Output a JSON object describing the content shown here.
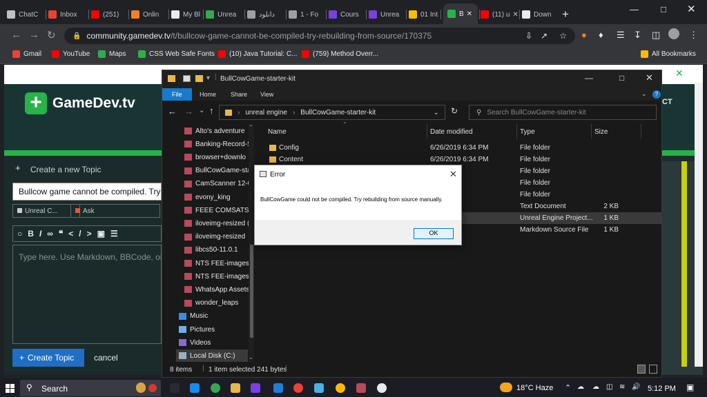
{
  "browser": {
    "tabs": [
      {
        "label": "ChatC",
        "color": "#bdc1c6"
      },
      {
        "label": "Inbox",
        "color": "#ea4335"
      },
      {
        "label": "(251)",
        "color": "#ff0000"
      },
      {
        "label": "Onlin",
        "color": "#f48024"
      },
      {
        "label": "My Bl",
        "color": "#e8eaed"
      },
      {
        "label": "Unrea",
        "color": "#34a853"
      },
      {
        "label": "دانلود",
        "color": "#9aa0a6"
      },
      {
        "label": "1 - Fo",
        "color": "#9aa0a6"
      },
      {
        "label": "Cours",
        "color": "#7b3fe4"
      },
      {
        "label": "Unrea",
        "color": "#7b3fe4"
      },
      {
        "label": "01 Int",
        "color": "#fbbc04"
      },
      {
        "label": "B",
        "color": "#27b24a"
      },
      {
        "label": "(11) u",
        "color": "#ff0000"
      },
      {
        "label": "Down",
        "color": "#e8eaed"
      }
    ],
    "new_tab": "+",
    "url_host": "community.gamedev.tv",
    "url_path": "/t/bullcow-game-cannot-be-compiled-try-rebuilding-from-source/170375",
    "bookmarks": [
      {
        "label": "Gmail",
        "color": "#ea4335"
      },
      {
        "label": "YouTube",
        "color": "#ff0000"
      },
      {
        "label": "Maps",
        "color": "#34a853"
      },
      {
        "label": "CSS Web Safe Fonts",
        "color": "#27b24a"
      },
      {
        "label": "(10) Java Tutorial: C...",
        "color": "#ff0000"
      },
      {
        "label": "(759) Method Overr...",
        "color": "#ff0000"
      }
    ],
    "all_bookmarks": "All Bookmarks"
  },
  "gamedev": {
    "logo": "GameDev.tv",
    "header_right": "CT",
    "create_topic_header": "Create a new Topic",
    "title_value": "Bullcow game cannot be compiled. Try",
    "category": "Unreal C...",
    "tag": "Ask",
    "editor_placeholder": "Type here. Use Markdown, BBCode, or",
    "create_button": "Create Topic",
    "cancel_link": "cancel"
  },
  "explorer": {
    "title": "BullCowGame-starter-kit",
    "ribbon_tabs": [
      "File",
      "Home",
      "Share",
      "View"
    ],
    "path": [
      "unreal engine",
      "BullCowGame-starter-kit"
    ],
    "search_placeholder": "Search BullCowGame-starter-kit",
    "nav_items": [
      {
        "label": "Alto's adventure",
        "type": "archive"
      },
      {
        "label": "Banking-Record-S",
        "type": "archive"
      },
      {
        "label": "browser+downlo",
        "type": "archive"
      },
      {
        "label": "BullCowGame-sta",
        "type": "archive"
      },
      {
        "label": "CamScanner 12-0",
        "type": "archive"
      },
      {
        "label": "evony_king",
        "type": "archive"
      },
      {
        "label": "FEEE COMSATS-ir",
        "type": "archive"
      },
      {
        "label": "iloveimg-resized (",
        "type": "archive"
      },
      {
        "label": "iloveimg-resized",
        "type": "archive"
      },
      {
        "label": "libcs50-11.0.1",
        "type": "archive"
      },
      {
        "label": "NTS FEE-images (",
        "type": "archive"
      },
      {
        "label": "NTS FEE-images",
        "type": "archive"
      },
      {
        "label": "WhatsApp Assets",
        "type": "archive"
      },
      {
        "label": "wonder_leaps",
        "type": "archive"
      },
      {
        "label": "Music",
        "type": "music"
      },
      {
        "label": "Pictures",
        "type": "pictures"
      },
      {
        "label": "Videos",
        "type": "videos"
      },
      {
        "label": "Local Disk (C:)",
        "type": "disk"
      }
    ],
    "columns": [
      "Name",
      "Date modified",
      "Type",
      "Size"
    ],
    "rows": [
      {
        "name": "Config",
        "date": "6/26/2019 6:34 PM",
        "type": "File folder",
        "size": "",
        "folder": true,
        "selected": false
      },
      {
        "name": "Content",
        "date": "6/26/2019 6:34 PM",
        "type": "File folder",
        "size": "",
        "folder": true,
        "selected": false
      },
      {
        "name": "",
        "date": "4:58 PM",
        "type": "File folder",
        "size": "",
        "folder": false,
        "selected": false
      },
      {
        "name": "",
        "date": "4:58 PM",
        "type": "File folder",
        "size": "",
        "folder": false,
        "selected": false
      },
      {
        "name": "",
        "date": "6:34 PM",
        "type": "File folder",
        "size": "",
        "folder": false,
        "selected": false
      },
      {
        "name": "",
        "date": "6:34 PM",
        "type": "Text Document",
        "size": "2 KB",
        "folder": false,
        "selected": false
      },
      {
        "name": "",
        "date": "6:34 PM",
        "type": "Unreal Engine Project...",
        "size": "1 KB",
        "folder": false,
        "selected": true
      },
      {
        "name": "",
        "date": "6:34 PM",
        "type": "Markdown Source File",
        "size": "1 KB",
        "folder": false,
        "selected": false
      }
    ],
    "status_items": "8 items",
    "status_selected": "1 item selected  241 bytes"
  },
  "dialog": {
    "title": "Error",
    "message": "BullCowGame could not be compiled. Try rebuilding from source manually.",
    "ok": "OK"
  },
  "taskbar": {
    "search": "Search",
    "weather": "18°C  Haze",
    "time": "5:12 PM"
  }
}
